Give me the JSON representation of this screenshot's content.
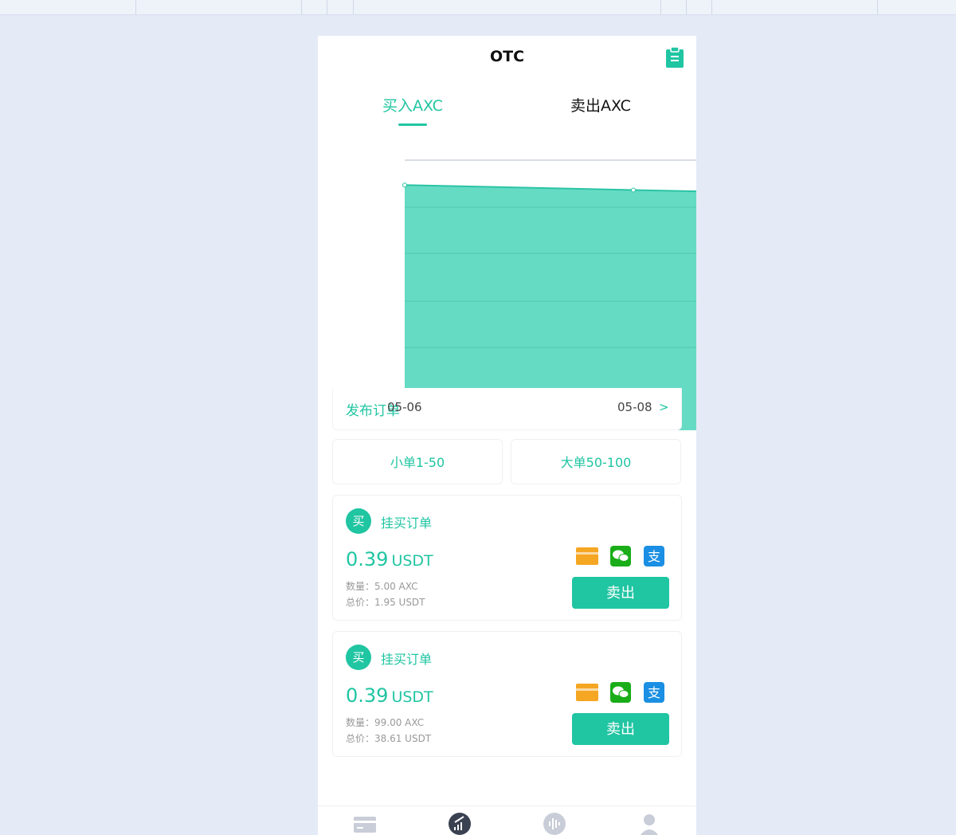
{
  "header": {
    "title": "OTC",
    "record_icon": "clipboard-icon"
  },
  "tabs": [
    {
      "label": "买入AXC",
      "active": true
    },
    {
      "label": "卖出AXC",
      "active": false
    }
  ],
  "chart_data": {
    "type": "area",
    "x": [
      "05-06",
      "05-07",
      "05-08"
    ],
    "values": [
      0.39,
      0.389,
      0.388
    ],
    "x_tick_labels": [
      "05-06",
      "05-08"
    ],
    "ylim": [
      0.34,
      0.392
    ],
    "grid": true,
    "color": "#66dbc4"
  },
  "post_order": {
    "label": "发布订单",
    "chevron": ">"
  },
  "filters": [
    {
      "label": "小单1-50"
    },
    {
      "label": "大单50-100"
    }
  ],
  "orders": [
    {
      "badge": "买",
      "title": "挂买订单",
      "price": "0.39",
      "unit": "USDT",
      "quantity": "数量：5.00 AXC",
      "total": "总价：1.95 USDT",
      "payments": [
        "bank-card-icon",
        "wechat-pay-icon",
        "alipay-icon"
      ],
      "action": "卖出"
    },
    {
      "badge": "买",
      "title": "挂买订单",
      "price": "0.39",
      "unit": "USDT",
      "quantity": "数量：99.00 AXC",
      "total": "总价：38.61 USDT",
      "payments": [
        "bank-card-icon",
        "wechat-pay-icon",
        "alipay-icon"
      ],
      "action": "卖出"
    }
  ],
  "bottom_nav": [
    "wallet-icon",
    "trade-icon",
    "voice-icon",
    "profile-icon"
  ],
  "colors": {
    "accent": "#20c5a2",
    "chart_fill": "#66dbc4",
    "bank": "#f5a623",
    "wechat": "#1aad19",
    "alipay": "#1a8fe3"
  }
}
